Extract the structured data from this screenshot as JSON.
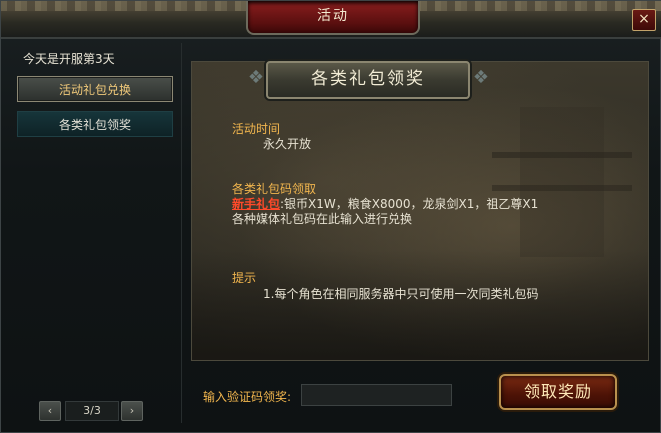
{
  "window": {
    "title": "活动",
    "close_label": "×"
  },
  "sidebar": {
    "server_days": "今天是开服第3天",
    "items": [
      {
        "label": "活动礼包兑换"
      },
      {
        "label": "各类礼包领奖"
      }
    ],
    "pager": {
      "prev": "‹",
      "page": "3/3",
      "next": "›"
    }
  },
  "main": {
    "header": "各类礼包领奖",
    "time_label": "活动时间",
    "time_value": "永久开放",
    "code_label": "各类礼包码领取",
    "gift_name": "新手礼包",
    "gift_reward": ":银币X1W，粮食X8000，龙泉剑X1，祖乙尊X1",
    "media_note": "各种媒体礼包码在此输入进行兑换",
    "tip_label": "提示",
    "tip_text": "1.每个角色在相同服务器中只可使用一次同类礼包码"
  },
  "footer": {
    "input_label": "输入验证码领奖:",
    "input_value": "",
    "claim_button": "领取奖励"
  }
}
